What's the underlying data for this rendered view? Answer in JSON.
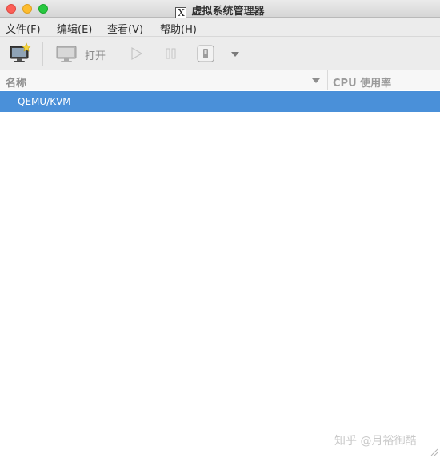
{
  "window": {
    "title": "虚拟系统管理器",
    "app_icon": "x11-icon",
    "app_icon_glyph": "X"
  },
  "menu": {
    "items": [
      {
        "label": "文件(F)"
      },
      {
        "label": "编辑(E)"
      },
      {
        "label": "查看(V)"
      },
      {
        "label": "帮助(H)"
      }
    ]
  },
  "toolbar": {
    "new_vm_icon": "new-vm-icon",
    "open_icon": "monitor-icon",
    "open_label": "打开",
    "run_icon": "play-icon",
    "pause_icon": "pause-icon",
    "shutdown_icon": "shutdown-icon",
    "dropdown_icon": "chevron-down-icon"
  },
  "columns": {
    "name": "名称",
    "cpu": "CPU 使用率"
  },
  "rows": [
    {
      "label": "QEMU/KVM",
      "selected": true
    }
  ],
  "watermark": "知乎 @月裕御酷",
  "colors": {
    "selection": "#4a90d9",
    "close": "#fc5f57",
    "minimize": "#fdbc2e",
    "maximize": "#28c840"
  }
}
